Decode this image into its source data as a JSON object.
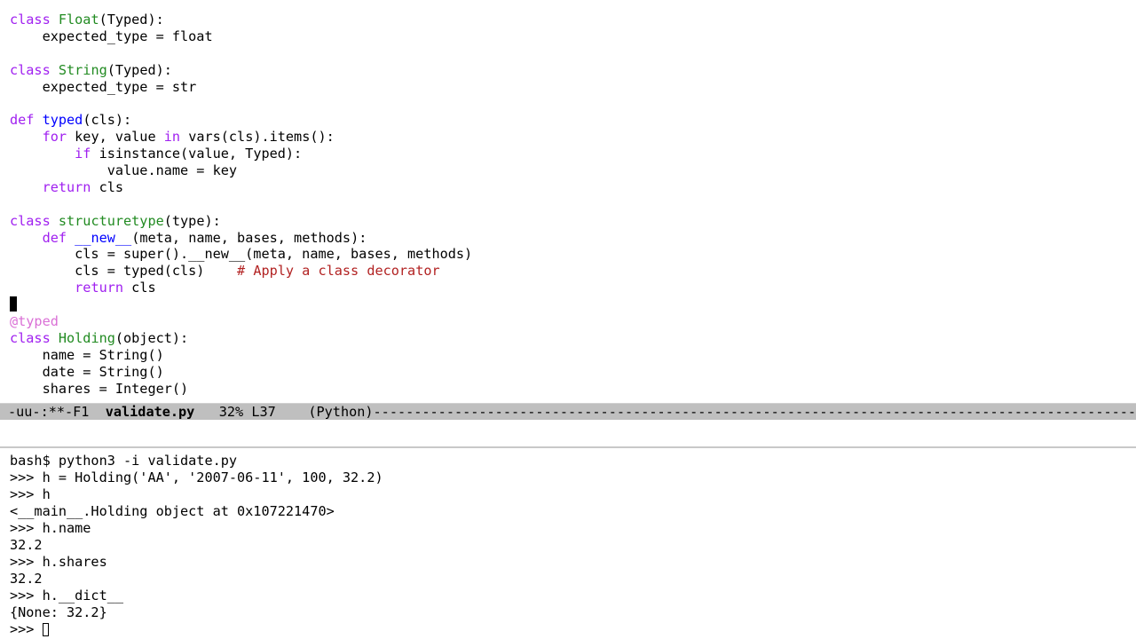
{
  "editor": {
    "app": "emacs",
    "buffer_name": "validate.py",
    "language": "Python",
    "colors": {
      "background": "#ffffff",
      "foreground": "#000000",
      "keyword": "#a020f0",
      "type_name": "#228b22",
      "function_name": "#0000ff",
      "comment": "#b22222",
      "decorator": "#da70d6",
      "mode_line_bg": "#bfbfbf"
    },
    "lines": [
      {
        "id": 1,
        "tokens": [
          {
            "t": "class",
            "c": "kw"
          },
          {
            "t": " ",
            "c": "plain"
          },
          {
            "t": "Float",
            "c": "type"
          },
          {
            "t": "(Typed):",
            "c": "plain"
          }
        ]
      },
      {
        "id": 2,
        "tokens": [
          {
            "t": "    expected_type = float",
            "c": "plain"
          }
        ]
      },
      {
        "id": 3,
        "tokens": [
          {
            "t": " ",
            "c": "plain"
          }
        ]
      },
      {
        "id": 4,
        "tokens": [
          {
            "t": "class",
            "c": "kw"
          },
          {
            "t": " ",
            "c": "plain"
          },
          {
            "t": "String",
            "c": "type"
          },
          {
            "t": "(Typed):",
            "c": "plain"
          }
        ]
      },
      {
        "id": 5,
        "tokens": [
          {
            "t": "    expected_type = str",
            "c": "plain"
          }
        ]
      },
      {
        "id": 6,
        "tokens": [
          {
            "t": " ",
            "c": "plain"
          }
        ]
      },
      {
        "id": 7,
        "tokens": [
          {
            "t": "def",
            "c": "kw"
          },
          {
            "t": " ",
            "c": "plain"
          },
          {
            "t": "typed",
            "c": "fn"
          },
          {
            "t": "(cls):",
            "c": "plain"
          }
        ]
      },
      {
        "id": 8,
        "tokens": [
          {
            "t": "    ",
            "c": "plain"
          },
          {
            "t": "for",
            "c": "kw"
          },
          {
            "t": " key, value ",
            "c": "plain"
          },
          {
            "t": "in",
            "c": "kw"
          },
          {
            "t": " vars(cls).items():",
            "c": "plain"
          }
        ]
      },
      {
        "id": 9,
        "tokens": [
          {
            "t": "        ",
            "c": "plain"
          },
          {
            "t": "if",
            "c": "kw"
          },
          {
            "t": " isinstance(value, Typed):",
            "c": "plain"
          }
        ]
      },
      {
        "id": 10,
        "tokens": [
          {
            "t": "            value.name = key",
            "c": "plain"
          }
        ]
      },
      {
        "id": 11,
        "tokens": [
          {
            "t": "    ",
            "c": "plain"
          },
          {
            "t": "return",
            "c": "kw"
          },
          {
            "t": " cls",
            "c": "plain"
          }
        ]
      },
      {
        "id": 12,
        "tokens": [
          {
            "t": " ",
            "c": "plain"
          }
        ]
      },
      {
        "id": 13,
        "tokens": [
          {
            "t": "class",
            "c": "kw"
          },
          {
            "t": " ",
            "c": "plain"
          },
          {
            "t": "structuretype",
            "c": "type"
          },
          {
            "t": "(type):",
            "c": "plain"
          }
        ]
      },
      {
        "id": 14,
        "tokens": [
          {
            "t": "    ",
            "c": "plain"
          },
          {
            "t": "def",
            "c": "kw"
          },
          {
            "t": " ",
            "c": "plain"
          },
          {
            "t": "__new__",
            "c": "fn"
          },
          {
            "t": "(meta, name, bases, methods):",
            "c": "plain"
          }
        ]
      },
      {
        "id": 15,
        "tokens": [
          {
            "t": "        cls = super().__new__(meta, name, bases, methods)",
            "c": "plain"
          }
        ]
      },
      {
        "id": 16,
        "tokens": [
          {
            "t": "        cls = typed(cls)",
            "c": "plain"
          },
          {
            "t": "    ",
            "c": "plain"
          },
          {
            "t": "# Apply a class decorator",
            "c": "cmt"
          }
        ]
      },
      {
        "id": 17,
        "tokens": [
          {
            "t": "        ",
            "c": "plain"
          },
          {
            "t": "return",
            "c": "kw"
          },
          {
            "t": " cls",
            "c": "plain"
          }
        ]
      },
      {
        "id": 18,
        "tokens": [
          {
            "t": "",
            "c": "cursor"
          }
        ]
      },
      {
        "id": 19,
        "tokens": [
          {
            "t": "@typed",
            "c": "dec"
          }
        ]
      },
      {
        "id": 20,
        "tokens": [
          {
            "t": "class",
            "c": "kw"
          },
          {
            "t": " ",
            "c": "plain"
          },
          {
            "t": "Holding",
            "c": "type"
          },
          {
            "t": "(object):",
            "c": "plain"
          }
        ]
      },
      {
        "id": 21,
        "tokens": [
          {
            "t": "    name = String()",
            "c": "plain"
          }
        ]
      },
      {
        "id": 22,
        "tokens": [
          {
            "t": "    date = String()",
            "c": "plain"
          }
        ]
      },
      {
        "id": 23,
        "tokens": [
          {
            "t": "    shares = Integer()",
            "c": "plain"
          }
        ]
      }
    ],
    "mode_line": {
      "status_flags": "-uu-:**-F1",
      "separator_1": "  ",
      "buffer_name": "validate.py",
      "separator_2": "   ",
      "scroll_percent": "32%",
      "line_number": "L37",
      "separator_3": "    ",
      "major_mode": "(Python)",
      "fill": "----------------------------------------------------------------------------------------------"
    }
  },
  "terminal": {
    "lines": [
      {
        "id": 1,
        "text": "bash$ python3 -i validate.py"
      },
      {
        "id": 2,
        "text": ">>> h = Holding('AA', '2007-06-11', 100, 32.2)"
      },
      {
        "id": 3,
        "text": ">>> h"
      },
      {
        "id": 4,
        "text": "<__main__.Holding object at 0x107221470>"
      },
      {
        "id": 5,
        "text": ">>> h.name"
      },
      {
        "id": 6,
        "text": "32.2"
      },
      {
        "id": 7,
        "text": ">>> h.shares"
      },
      {
        "id": 8,
        "text": "32.2"
      },
      {
        "id": 9,
        "text": ">>> h.__dict__"
      },
      {
        "id": 10,
        "text": "{None: 32.2}"
      }
    ],
    "prompt": ">>> ",
    "cursor": "hollow-block"
  }
}
